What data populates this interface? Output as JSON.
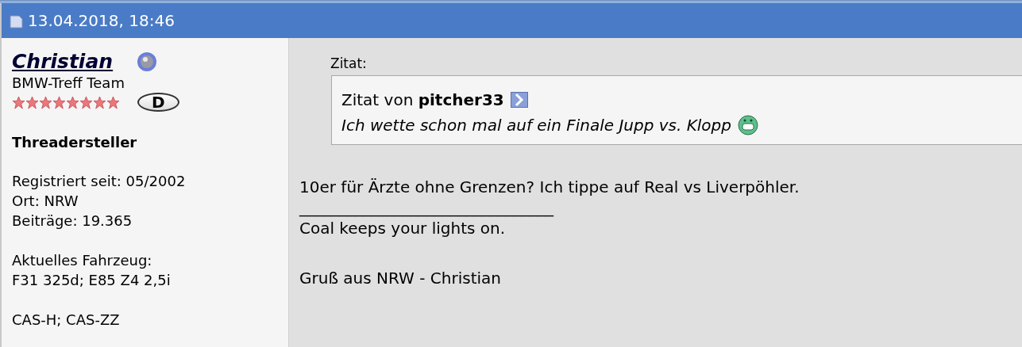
{
  "post_header": {
    "date": "13.04.2018, 18:46"
  },
  "user": {
    "name": "Christian",
    "online": true,
    "title": "BMW-Treff Team",
    "stars": 8,
    "country": "D",
    "role": "Threadersteller",
    "info": [
      [
        "Registriert seit: 05/2002",
        "Ort: NRW",
        "Beiträge: 19.365"
      ],
      [
        "Aktuelles Fahrzeug:",
        "F31 325d; E85 Z4 2,5i"
      ],
      [
        "CAS-H; CAS-ZZ"
      ]
    ]
  },
  "post": {
    "quote_label": "Zitat:",
    "quote_prefix": "Zitat von",
    "quote_author": "pitcher33",
    "quote_text": "Ich wette schon mal auf ein Finale Jupp vs. Klopp",
    "message": "10er für Ärzte ohne Grenzen? Ich tippe auf Real vs Liverpöhler.",
    "signature_rule": "________________________________",
    "signature": [
      "Coal keeps your lights on.",
      "Gruß aus NRW - Christian"
    ]
  }
}
